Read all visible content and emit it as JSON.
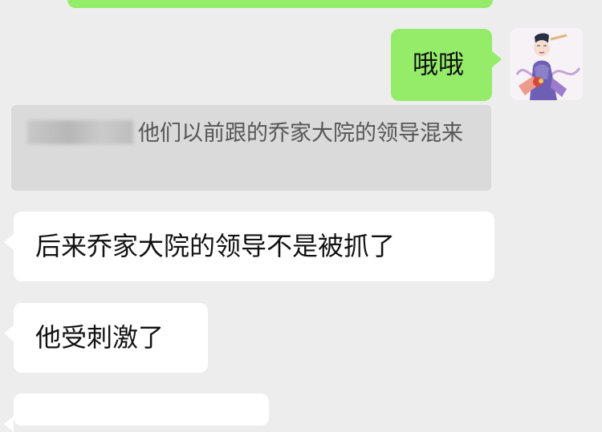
{
  "messages": {
    "top_partial": "",
    "self_reply": "哦哦",
    "quoted_text": "他们以前跟的乔家大院的领导混来",
    "incoming_1": "后来乔家大院的领导不是被抓了",
    "incoming_2": "他受刺激了"
  },
  "colors": {
    "background": "#ededed",
    "outgoing_bubble": "#95ec69",
    "incoming_bubble": "#ffffff",
    "quote_bubble": "#dadada"
  },
  "icons": {
    "avatar": "robed-figure-avatar-icon"
  }
}
